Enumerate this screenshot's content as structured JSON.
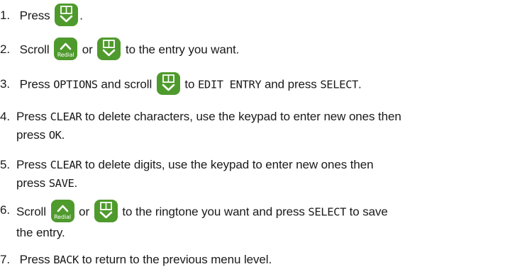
{
  "steps": [
    {
      "number": "1.",
      "text_1": "Press",
      "text_2": "."
    },
    {
      "number": "2.",
      "text_1": "Scroll",
      "text_2": "or",
      "text_3": "to the entry you want."
    },
    {
      "number": "3.",
      "text_1": "Press",
      "cmd_1": "OPTIONS",
      "text_2": "and scroll",
      "text_3": "to",
      "cmd_2": "EDIT ENTRY",
      "text_4": "and press",
      "cmd_3": "SELECT",
      "text_5": "."
    },
    {
      "number": "4.",
      "text_1": "Press",
      "cmd_1": "CLEAR",
      "text_2": "to delete characters, use the keypad to enter new ones then",
      "text_3": "press",
      "cmd_2": "OK",
      "text_4": "."
    },
    {
      "number": "5.",
      "text_1": "Press",
      "cmd_1": "CLEAR",
      "text_2": "to delete digits, use the keypad to enter new ones then",
      "text_3": "press",
      "cmd_2": "SAVE",
      "text_4": "."
    },
    {
      "number": "6.",
      "text_1": "Scroll",
      "text_2": "or",
      "text_3": "to the ringtone you want and press",
      "cmd_1": "SELECT",
      "text_4": "to save",
      "text_5": "the entry."
    },
    {
      "number": "7.",
      "text_1": "Press",
      "cmd_1": "BACK",
      "text_2": "to return to the previous menu level."
    }
  ],
  "keys": {
    "redial_label": "Redial"
  },
  "icons": {
    "phonebook_down": "phonebook-down-icon",
    "redial_up": "redial-up-icon"
  },
  "colors": {
    "key_green": "#4f9a2c",
    "text": "#1a1a1a"
  }
}
